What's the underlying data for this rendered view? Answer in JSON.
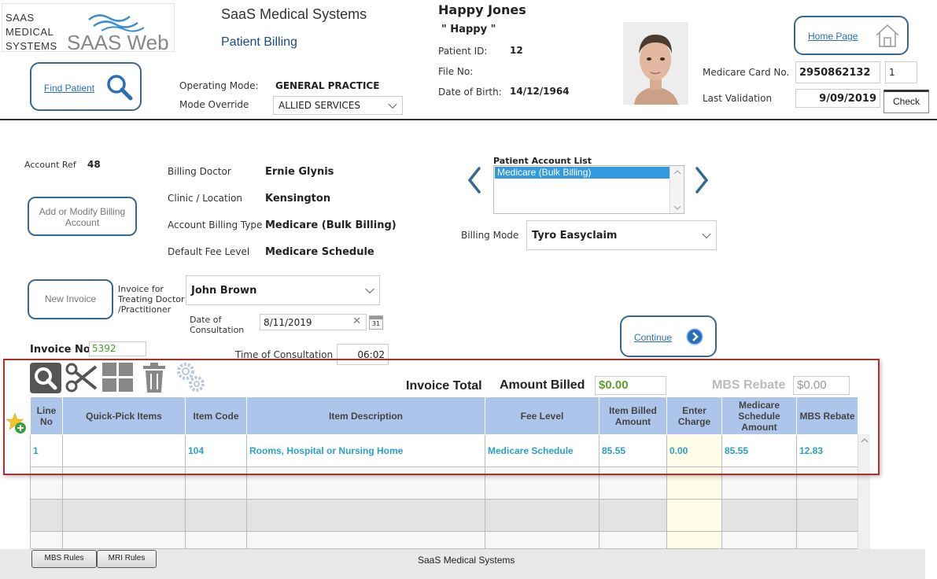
{
  "header": {
    "logo_lines": [
      "SAAS",
      "MEDICAL",
      "SYSTEMS"
    ],
    "logo_web": "SAAS Web",
    "company": "SaaS Medical Systems",
    "module": "Patient Billing",
    "find_patient": "Find Patient",
    "operating_mode_label": "Operating Mode:",
    "operating_mode_value": "GENERAL PRACTICE",
    "mode_override_label": "Mode Override",
    "mode_override_value": "ALLIED SERVICES",
    "home_page": "Home Page"
  },
  "patient": {
    "name": "Happy Jones",
    "nickname": "\" Happy \"",
    "id_label": "Patient ID:",
    "id_value": "12",
    "file_label": "File No:",
    "dob_label": "Date of Birth:",
    "dob_value": "14/12/1964",
    "medicare_label": "Medicare Card No.",
    "medicare_value": "2950862132",
    "medicare_irn": "1",
    "validation_label": "Last Validation",
    "validation_value": "9/09/2019",
    "check_label": "Check"
  },
  "account": {
    "ref_label": "Account Ref",
    "ref_value": "48",
    "add_modify": "Add or Modify Billing Account",
    "billing_doctor_label": "Billing Doctor",
    "billing_doctor_value": "Ernie Glynis",
    "clinic_label": "Clinic / Location",
    "clinic_value": "Kensington",
    "billing_type_label": "Account Billing Type",
    "billing_type_value": "Medicare (Bulk Billing)",
    "fee_level_label": "Default Fee Level",
    "fee_level_value": "Medicare Schedule",
    "list_title": "Patient Account List",
    "list_items": [
      "Medicare (Bulk Billing)"
    ],
    "billing_mode_label": "Billing Mode",
    "billing_mode_value": "Tyro Easyclaim"
  },
  "invoice": {
    "new_invoice": "New Invoice",
    "treating_label_1": "Invoice for",
    "treating_label_2": "Treating Doctor",
    "treating_label_3": "/Practitioner",
    "treating_value": "John Brown",
    "doc_label_1": "Date of",
    "doc_label_2": "Consultation",
    "doc_value": "8/11/2019",
    "calendar_day": "31",
    "continue": "Continue",
    "invoice_no_label": "Invoice No.",
    "invoice_no_value": "5392",
    "time_label": "Time of Consultation",
    "time_value": "06:02",
    "total_label": "Invoice Total",
    "amount_billed_label": "Amount Billed",
    "amount_billed_value": "$0.00",
    "mbs_rebate_label": "MBS Rebate",
    "mbs_rebate_value": "$0.00"
  },
  "table": {
    "headers": [
      "Line No",
      "Quick-Pick Items",
      "Item Code",
      "Item Description",
      "Fee Level",
      "Item Billed Amount",
      "Enter Charge",
      "Medicare Schedule Amount",
      "MBS Rebate"
    ],
    "rows": [
      [
        "1",
        "",
        "104",
        "Rooms, Hospital or Nursing Home",
        "Medicare Schedule",
        "85.55",
        "0.00",
        "85.55",
        "12.83"
      ]
    ]
  },
  "footer": {
    "mbs_rules": "MBS Rules",
    "mri_rules": "MRI Rules",
    "company": "SaaS Medical Systems"
  },
  "colors": {
    "accent": "#3a6792",
    "link": "#2a6fb7",
    "header_bg": "#adc5ea",
    "cell_text": "#2aa0c7",
    "green": "#5aa02c",
    "highlight_red": "#b03030"
  }
}
